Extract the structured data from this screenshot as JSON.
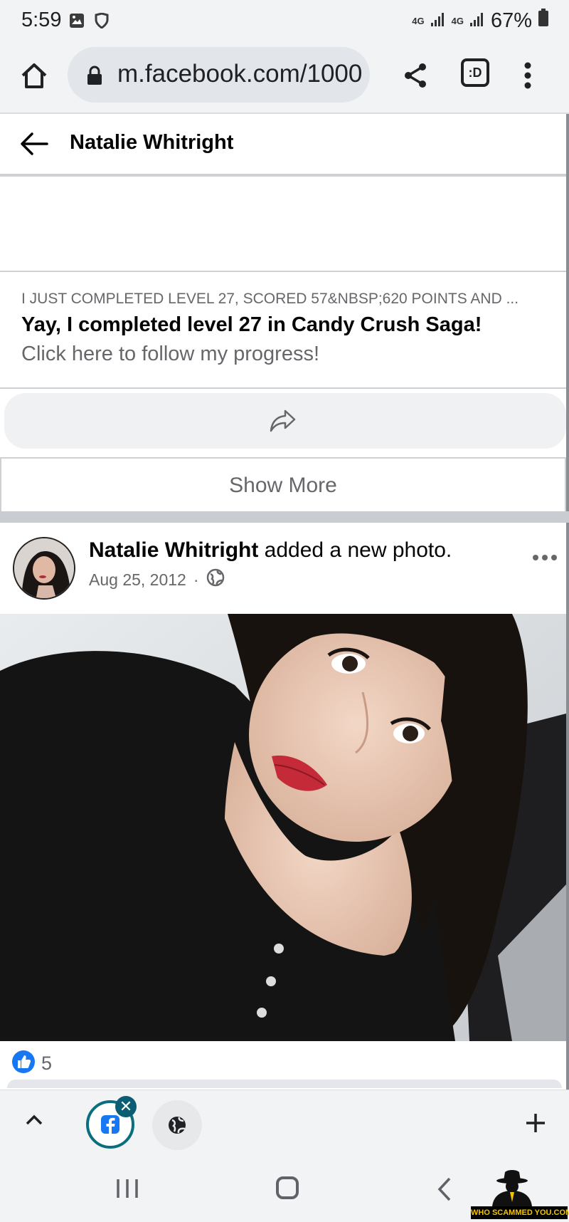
{
  "status_bar": {
    "time": "5:59",
    "network_1": "4G",
    "network_2": "4G",
    "battery": "67%"
  },
  "browser": {
    "url": "m.facebook.com/1000",
    "tabs_label": ":D"
  },
  "header": {
    "title": "Natalie Whitright"
  },
  "link_preview": {
    "domain_line": "I JUST COMPLETED LEVEL 27, SCORED 57&NBSP;620 POINTS AND ...",
    "title": "Yay, I completed level 27 in Candy Crush Saga!",
    "description": "Click here to follow my progress!"
  },
  "show_more_label": "Show More",
  "post": {
    "author": "Natalie Whitright",
    "action": " added a new photo.",
    "date": "Aug 25, 2012",
    "separator": "·",
    "like_count": "5"
  },
  "watermark": {
    "text": "WHO SCAMMED YOU.COM"
  },
  "colors": {
    "fb_blue": "#1877f2",
    "chrome_bg": "#f1f3f4",
    "divider": "#ced0d4"
  }
}
